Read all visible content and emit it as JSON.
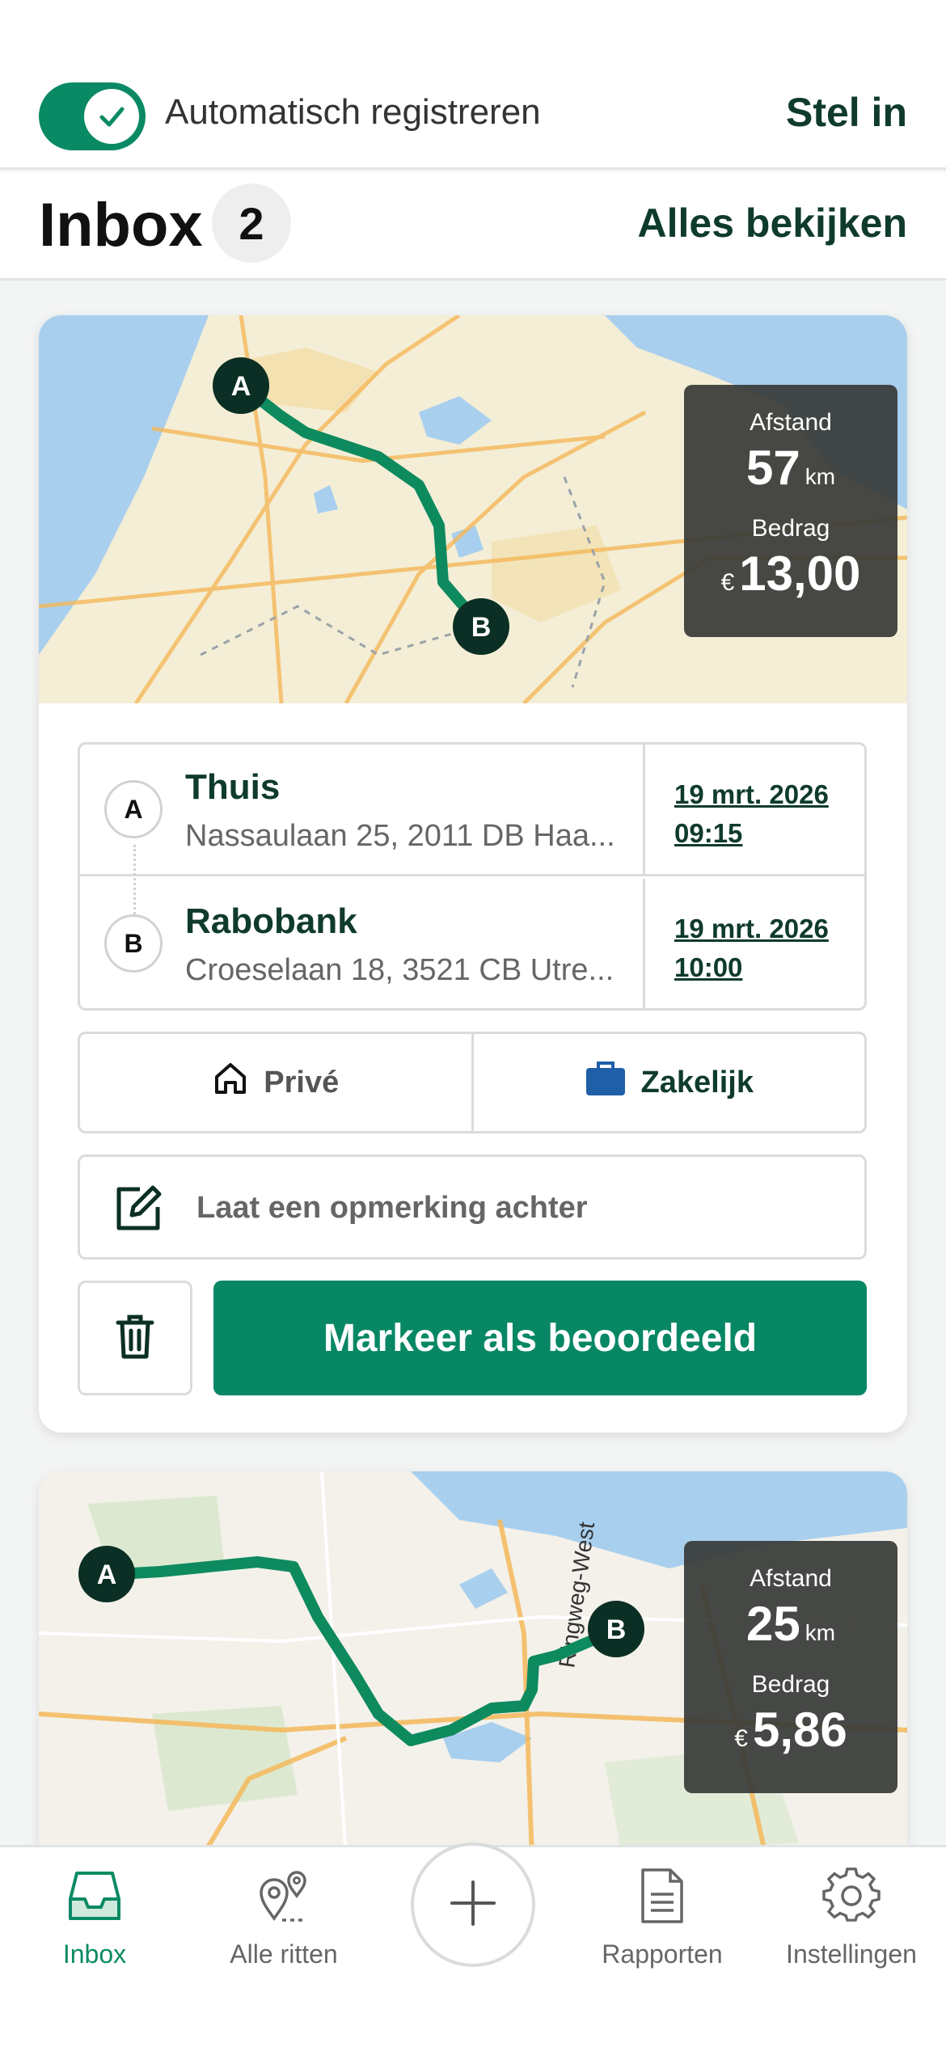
{
  "header": {
    "auto_register_label": "Automatisch registreren",
    "auto_register_on": true,
    "setup_link": "Stel in"
  },
  "inbox": {
    "title": "Inbox",
    "count": "2",
    "view_all": "Alles bekijken"
  },
  "trips": [
    {
      "distance_label": "Afstand",
      "distance": "57",
      "distance_unit": "km",
      "amount_label": "Bedrag",
      "currency": "€",
      "amount": "13,00",
      "start": {
        "marker": "A",
        "name": "Thuis",
        "address": "Nassaulaan 25, 2011 DB Haa...",
        "date": "19 mrt. 2026",
        "time": "09:15"
      },
      "end": {
        "marker": "B",
        "name": "Rabobank",
        "address": "Croeselaan 18, 3521 CB Utre...",
        "date": "19 mrt. 2026",
        "time": "10:00"
      },
      "private_label": "Privé",
      "business_label": "Zakelijk",
      "comment_placeholder": "Laat een opmerking achter",
      "mark_reviewed_label": "Markeer als beoordeeld"
    },
    {
      "distance_label": "Afstand",
      "distance": "25",
      "distance_unit": "km",
      "amount_label": "Bedrag",
      "currency": "€",
      "amount": "5,86",
      "map_road_label": "Ringweg-West",
      "start": {
        "marker": "A"
      },
      "end": {
        "marker": "B"
      }
    }
  ],
  "tabbar": {
    "items": [
      {
        "label": "Inbox",
        "icon": "inbox-icon",
        "active": true
      },
      {
        "label": "Alle ritten",
        "icon": "route-pins-icon",
        "active": false
      },
      {
        "label": "",
        "icon": "plus-icon",
        "active": false
      },
      {
        "label": "Rapporten",
        "icon": "document-icon",
        "active": false
      },
      {
        "label": "Instellingen",
        "icon": "gear-icon",
        "active": false
      }
    ]
  },
  "colors": {
    "brand_green": "#088764",
    "dark_green": "#0f3b2c",
    "route_green": "#0e8a5f",
    "stats_overlay": "#373a37"
  }
}
